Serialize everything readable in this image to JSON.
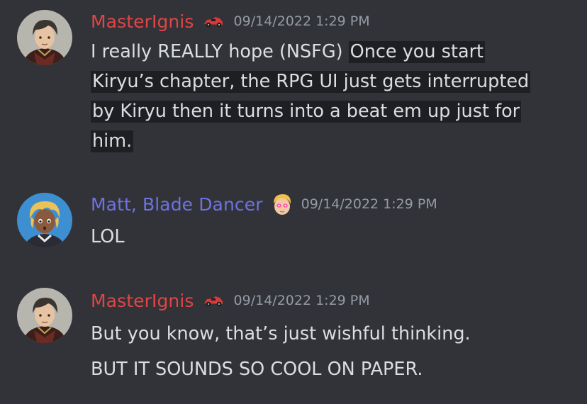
{
  "messages": [
    {
      "author": "MasterIgnis",
      "author_color": "#e04545",
      "role_icon": "red-car-icon",
      "timestamp": "09/14/2022 1:29 PM",
      "lines": [
        {
          "plain": "I really REALLY hope (NSFG) ",
          "highlight": "Once you start "
        },
        {
          "plain": "",
          "highlight": "Kiryu’s chapter, the RPG UI just gets interrupted "
        },
        {
          "plain": "",
          "highlight": "by Kiryu then it turns into a beat em up just for "
        },
        {
          "plain": "",
          "highlight": "him."
        }
      ]
    },
    {
      "author": "Matt, Blade Dancer",
      "author_color": "#6f72e0",
      "role_icon": "blonde-character-emoji-icon",
      "timestamp": "09/14/2022 1:29 PM",
      "lines": [
        "LOL"
      ]
    },
    {
      "author": "MasterIgnis",
      "author_color": "#e04545",
      "role_icon": "red-car-icon",
      "timestamp": "09/14/2022 1:29 PM",
      "lines": [
        "But you know, that’s just wishful thinking.",
        "BUT IT SOUNDS SO COOL ON PAPER."
      ]
    }
  ]
}
